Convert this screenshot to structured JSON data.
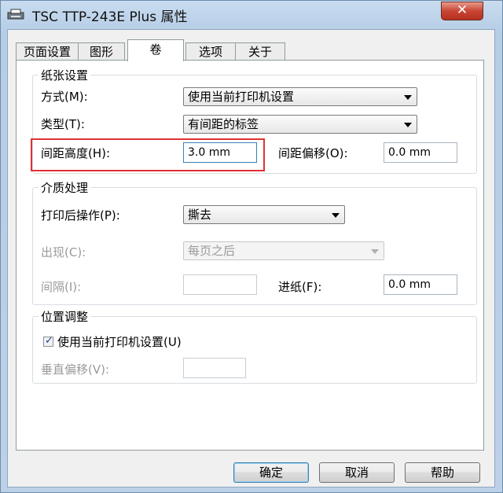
{
  "window": {
    "title": "TSC TTP-243E Plus 属性",
    "close_label": "✕"
  },
  "tabs": [
    {
      "label": "页面设置",
      "active": false
    },
    {
      "label": "图形",
      "active": false
    },
    {
      "label": "卷",
      "active": true
    },
    {
      "label": "选项",
      "active": false
    },
    {
      "label": "关于",
      "active": false
    }
  ],
  "paper": {
    "title": "纸张设置",
    "method_label": "方式(M):",
    "method_value": "使用当前打印机设置",
    "type_label": "类型(T):",
    "type_value": "有间距的标签",
    "gap_height_label": "间距高度(H):",
    "gap_height_value": "3.0 mm",
    "gap_offset_label": "间距偏移(O):",
    "gap_offset_value": "0.0 mm"
  },
  "media": {
    "title": "介质处理",
    "post_print_label": "打印后操作(P):",
    "post_print_value": "撕去",
    "occurrence_label": "出现(C):",
    "occurrence_value": "每页之后",
    "interval_label": "间隔(I):",
    "interval_value": "",
    "feed_label": "进纸(F):",
    "feed_value": "0.0 mm"
  },
  "position": {
    "title": "位置调整",
    "use_printer_label": "使用当前打印机设置(U)",
    "use_printer_checked": true,
    "vertical_offset_label": "垂直偏移(V):",
    "vertical_offset_value": ""
  },
  "buttons": {
    "ok": "确定",
    "cancel": "取消",
    "help": "帮助"
  },
  "colors": {
    "highlight": "#e03131",
    "close_button": "#c94535",
    "titlebar": "#c9dcf0"
  }
}
